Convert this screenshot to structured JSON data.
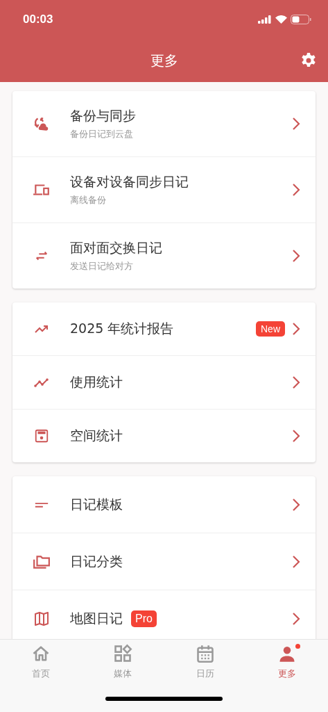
{
  "status_bar": {
    "time": "00:03"
  },
  "header": {
    "title": "更多"
  },
  "sections": [
    {
      "items": [
        {
          "title": "备份与同步",
          "subtitle": "备份日记到云盘"
        },
        {
          "title": "设备对设备同步日记",
          "subtitle": "离线备份"
        },
        {
          "title": "面对面交换日记",
          "subtitle": "发送日记给对方"
        }
      ]
    },
    {
      "items": [
        {
          "title": "2025 年统计报告",
          "badge": {
            "text": "New",
            "kind": "trailing"
          }
        },
        {
          "title": "使用统计"
        },
        {
          "title": "空间统计"
        }
      ]
    },
    {
      "items": [
        {
          "title": "日记模板"
        },
        {
          "title": "日记分类"
        },
        {
          "title": "地图日记",
          "badge": {
            "text": "Pro",
            "kind": "inline"
          }
        }
      ]
    }
  ],
  "tab_bar": [
    {
      "label": "首页",
      "selected": false,
      "notification": false
    },
    {
      "label": "媒体",
      "selected": false,
      "notification": false
    },
    {
      "label": "日历",
      "selected": false,
      "notification": false
    },
    {
      "label": "更多",
      "selected": true,
      "notification": true
    }
  ]
}
